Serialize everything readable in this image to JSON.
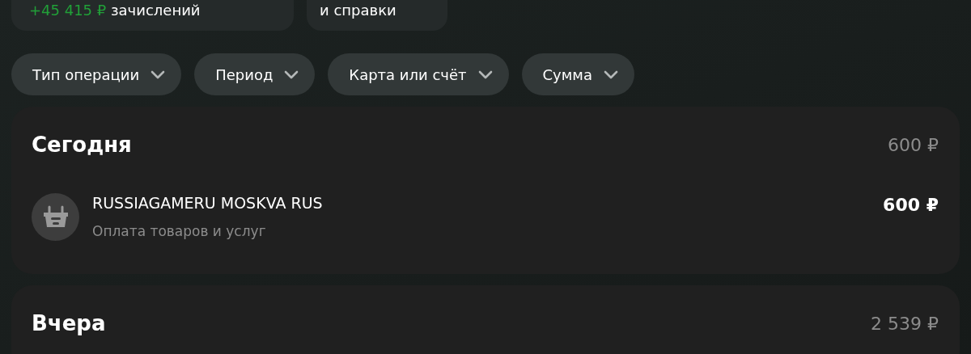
{
  "summary_cards": [
    {
      "amount": "+45 415 ₽",
      "label": "зачислений"
    },
    {
      "label": "и справки"
    }
  ],
  "filters": [
    {
      "label": "Тип операции"
    },
    {
      "label": "Период"
    },
    {
      "label": "Карта или счёт"
    },
    {
      "label": "Сумма"
    }
  ],
  "days": [
    {
      "title": "Сегодня",
      "total": "600 ₽",
      "operations": [
        {
          "merchant": "RUSSIAGAMERU MOSKVA RUS",
          "category": "Оплата товаров и услуг",
          "amount": "600 ₽"
        }
      ]
    },
    {
      "title": "Вчера",
      "total": "2 539 ₽"
    }
  ]
}
